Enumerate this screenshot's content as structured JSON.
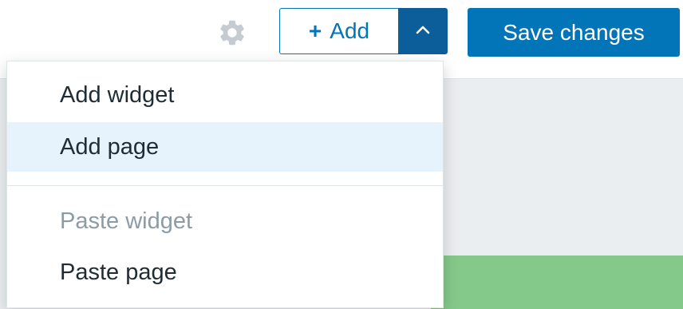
{
  "toolbar": {
    "settings_icon": "gear-icon",
    "add_label": "Add",
    "add_icon": "plus-icon",
    "toggle_icon": "chevron-up-icon",
    "save_label": "Save changes"
  },
  "add_menu": {
    "items": [
      {
        "label": "Add widget",
        "state": "normal"
      },
      {
        "label": "Add page",
        "state": "hovered"
      },
      {
        "label": "Paste widget",
        "state": "disabled"
      },
      {
        "label": "Paste page",
        "state": "normal"
      }
    ]
  },
  "colors": {
    "primary": "#0275b8",
    "primary_dark": "#0b5e9a",
    "menu_hover": "#e7f3fc",
    "disabled_text": "#8c9ba4",
    "widget_green": "#84c98a",
    "dashboard_bg": "#ebeef0"
  }
}
